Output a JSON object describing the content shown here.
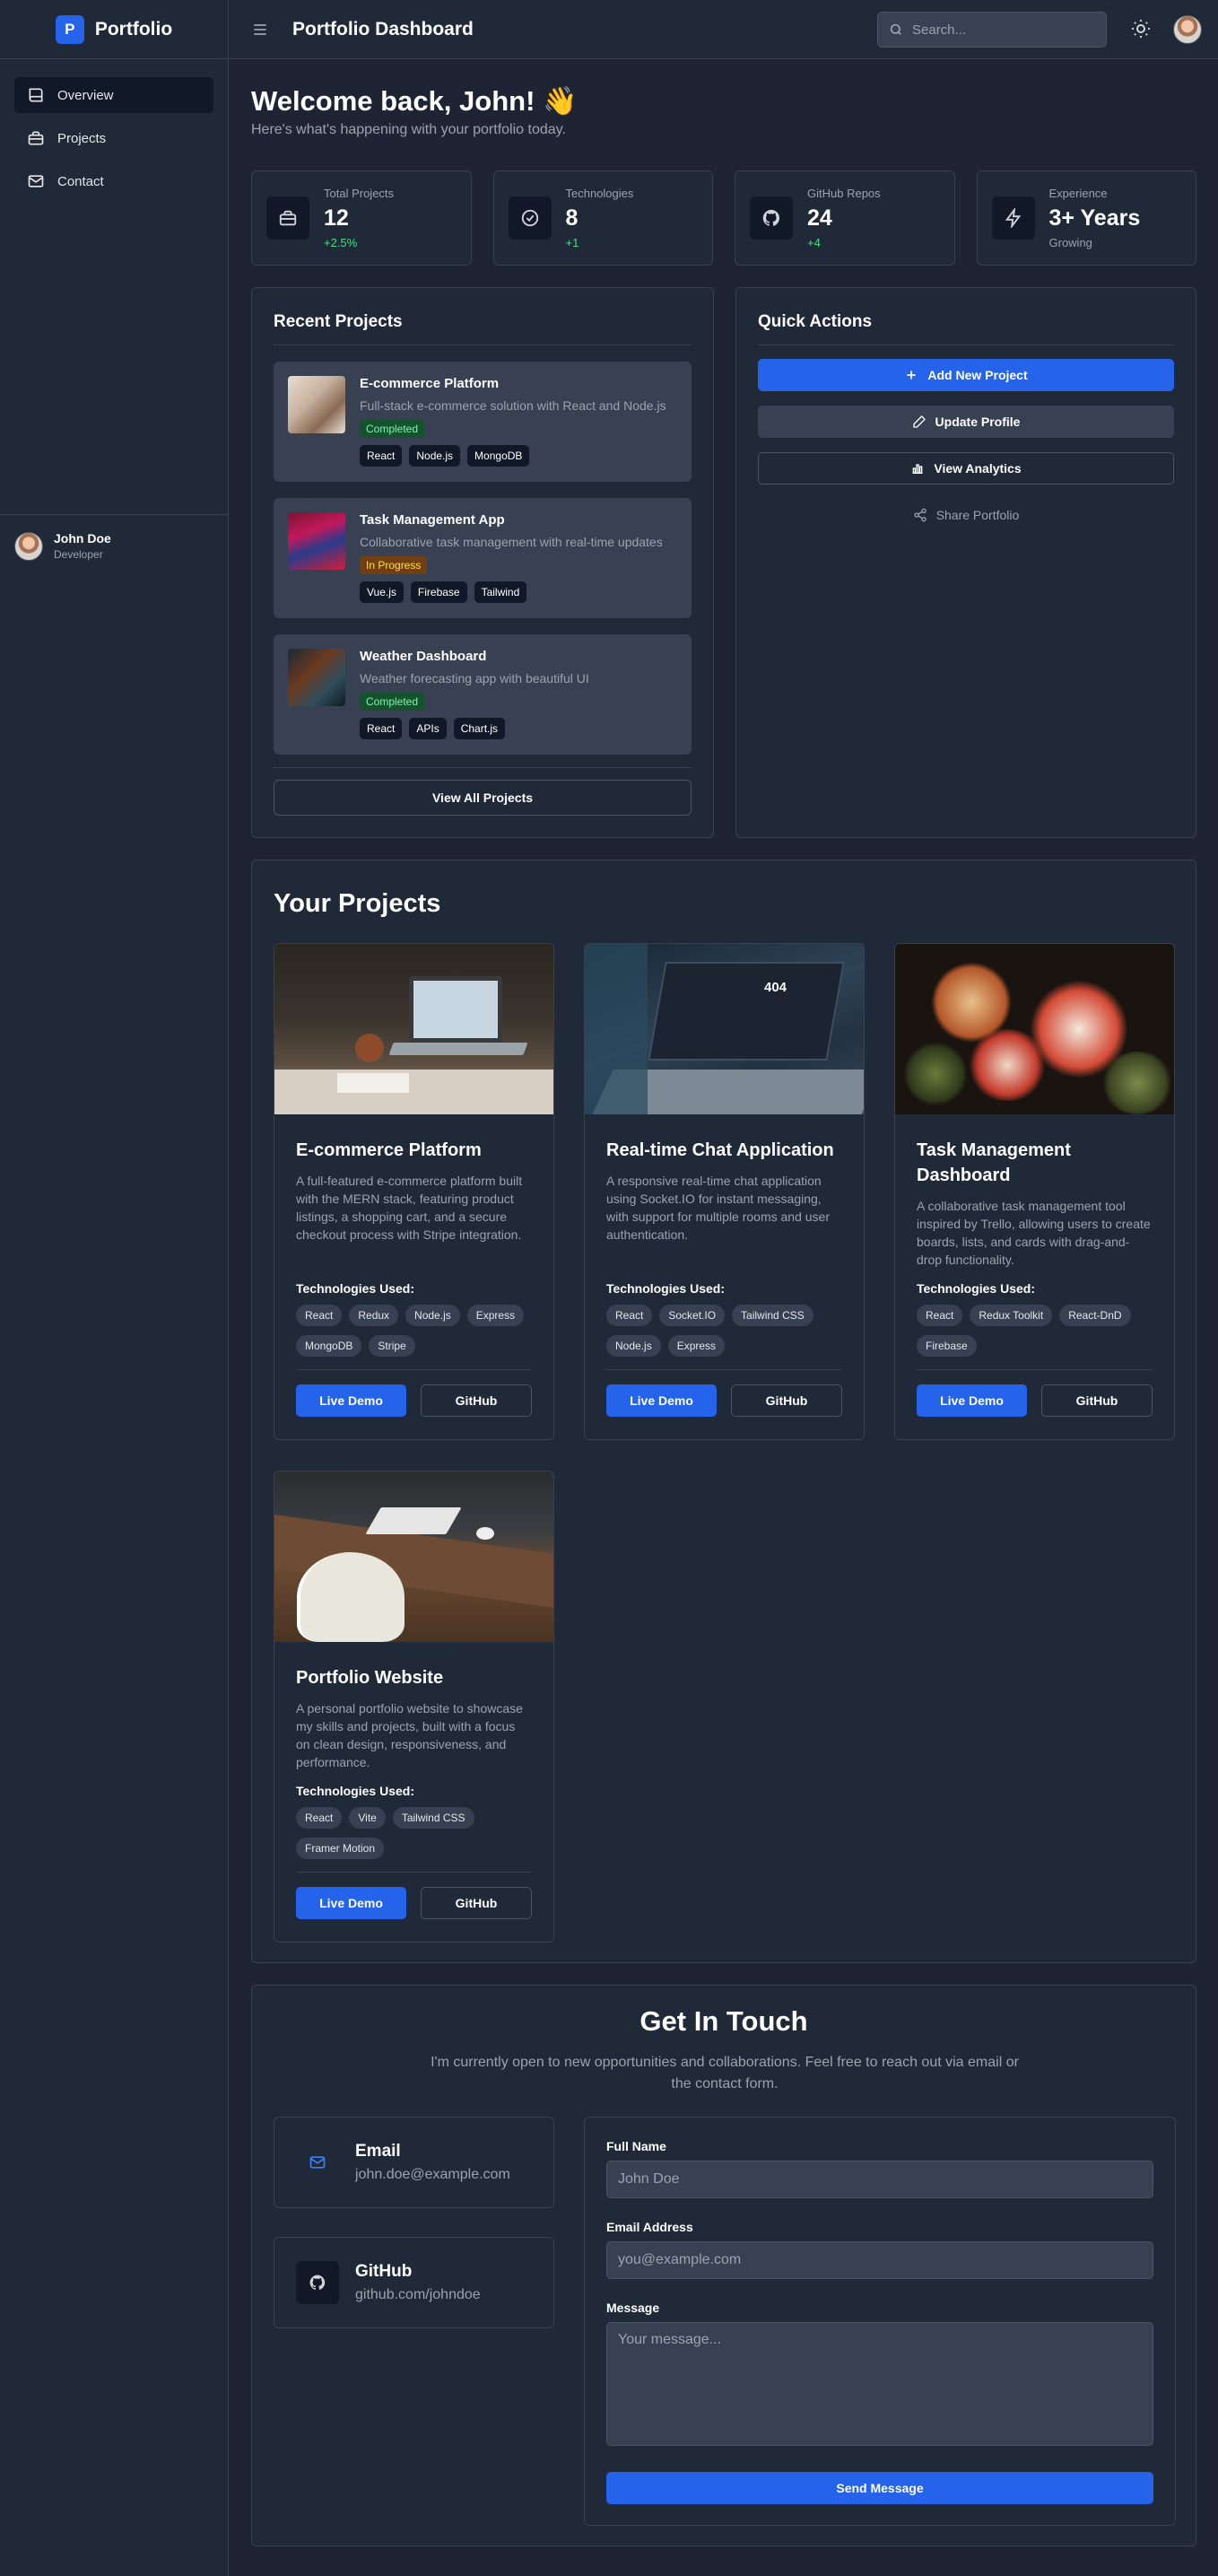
{
  "app": {
    "brand_initial": "P",
    "brand_name": "Portfolio"
  },
  "sidebar": {
    "items": [
      {
        "label": "Overview",
        "icon": "book-icon",
        "active": true
      },
      {
        "label": "Projects",
        "icon": "briefcase-icon"
      },
      {
        "label": "Contact",
        "icon": "mail-icon"
      }
    ],
    "user": {
      "name": "John Doe",
      "role": "Developer"
    }
  },
  "topbar": {
    "title": "Portfolio Dashboard",
    "search_placeholder": "Search...",
    "theme_icon": "sun-icon"
  },
  "welcome": {
    "title": "Welcome back, John! 👋",
    "subtitle": "Here's what's happening with your portfolio today."
  },
  "stats": [
    {
      "label": "Total Projects",
      "value": "12",
      "delta": "+2.5%",
      "icon": "briefcase-icon"
    },
    {
      "label": "Technologies",
      "value": "8",
      "delta": "+1",
      "icon": "check-circle-icon"
    },
    {
      "label": "GitHub Repos",
      "value": "24",
      "delta": "+4",
      "icon": "github-icon"
    },
    {
      "label": "Experience",
      "value": "3+ Years",
      "delta": "Growing",
      "icon": "bolt-icon"
    }
  ],
  "recent": {
    "title": "Recent Projects",
    "items": [
      {
        "name": "E-commerce Platform",
        "desc": "Full-stack e-commerce solution with React and Node.js",
        "status": "Completed",
        "tags": [
          "React",
          "Node.js",
          "MongoDB"
        ]
      },
      {
        "name": "Task Management App",
        "desc": "Collaborative task management with real-time updates",
        "status": "In Progress",
        "tags": [
          "Vue.js",
          "Firebase",
          "Tailwind"
        ]
      },
      {
        "name": "Weather Dashboard",
        "desc": "Weather forecasting app with beautiful UI",
        "status": "Completed",
        "tags": [
          "React",
          "APIs",
          "Chart.js"
        ]
      }
    ],
    "view_all": "View All Projects"
  },
  "quick": {
    "title": "Quick Actions",
    "actions": [
      {
        "label": "Add New Project",
        "icon": "plus-icon"
      },
      {
        "label": "Update Profile",
        "icon": "pencil-icon"
      },
      {
        "label": "View Analytics",
        "icon": "bar-chart-icon"
      },
      {
        "label": "Share Portfolio",
        "icon": "share-icon"
      }
    ]
  },
  "projects": {
    "title": "Your Projects",
    "tech_label": "Technologies Used:",
    "live_label": "Live Demo",
    "github_label": "GitHub",
    "cards": [
      {
        "title": "E-commerce Platform",
        "desc": "A full-featured e-commerce platform built with the MERN stack, featuring product listings, a shopping cart, and a secure checkout process with Stripe integration.",
        "tags": [
          "React",
          "Redux",
          "Node.js",
          "Express",
          "MongoDB",
          "Stripe"
        ]
      },
      {
        "title": "Real-time Chat Application",
        "desc": "A responsive real-time chat application using Socket.IO for instant messaging, with support for multiple rooms and user authentication.",
        "tags": [
          "React",
          "Socket.IO",
          "Tailwind CSS",
          "Node.js",
          "Express"
        ],
        "screen_text": "404"
      },
      {
        "title": "Task Management Dashboard",
        "desc": "A collaborative task management tool inspired by Trello, allowing users to create boards, lists, and cards with drag-and-drop functionality.",
        "tags": [
          "React",
          "Redux Toolkit",
          "React-DnD",
          "Firebase"
        ]
      },
      {
        "title": "Portfolio Website",
        "desc": "A personal portfolio website to showcase my skills and projects, built with a focus on clean design, responsiveness, and performance.",
        "tags": [
          "React",
          "Vite",
          "Tailwind CSS",
          "Framer Motion"
        ]
      }
    ]
  },
  "contact": {
    "title": "Get In Touch",
    "subtitle": "I'm currently open to new opportunities and collaborations. Feel free to reach out via email or the contact form.",
    "email": {
      "title": "Email",
      "value": "john.doe@example.com"
    },
    "github": {
      "title": "GitHub",
      "value": "github.com/johndoe"
    },
    "form": {
      "name_label": "Full Name",
      "name_placeholder": "John Doe",
      "email_label": "Email Address",
      "email_placeholder": "you@example.com",
      "message_label": "Message",
      "message_placeholder": "Your message...",
      "submit": "Send Message"
    }
  },
  "colors": {
    "accent": "#2563eb",
    "bg": "#1e2433",
    "panel": "#1f2937",
    "success": "#4ade80"
  }
}
